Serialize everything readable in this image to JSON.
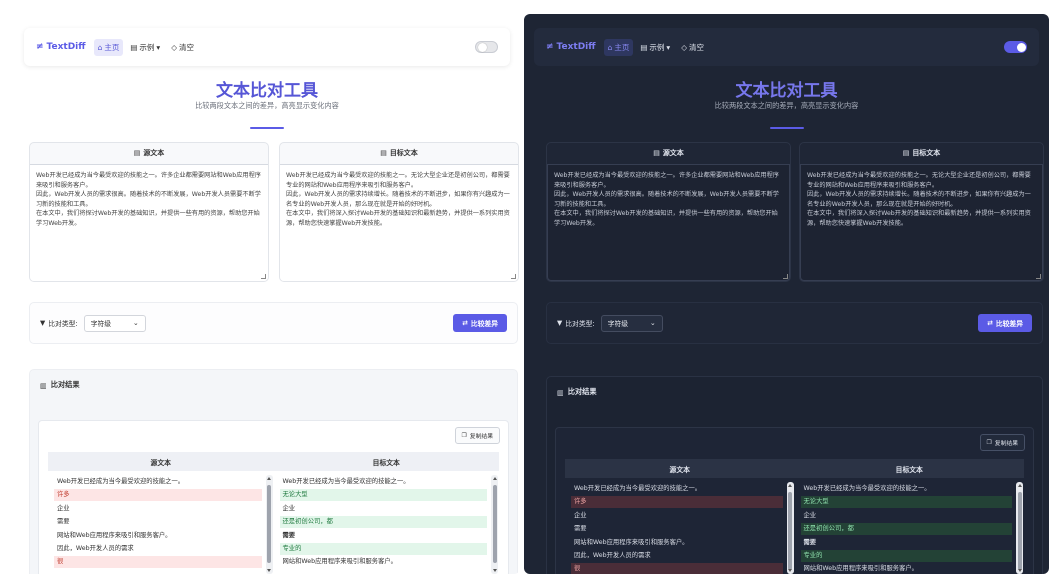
{
  "nav": {
    "brand": "TextDiff",
    "home": "主页",
    "examples": "示例",
    "clear": "清空"
  },
  "hero": {
    "title": "文本比对工具",
    "subtitle": "比较两段文本之间的差异，高亮显示变化内容"
  },
  "source": {
    "label": "源文本",
    "text": "Web开发已经成为当今最受欢迎的技能之一。许多企业都需要网站和Web应用程序来吸引和服务客户。\n因此，Web开发人员的需求很高。随着技术的不断发展，Web开发人员需要不断学习新的技能和工具。\n在本文中，我们将探讨Web开发的基础知识，并提供一些有用的资源，帮助您开始学习Web开发。"
  },
  "target": {
    "label": "目标文本",
    "text": "Web开发已经成为当今最受欢迎的技能之一。无论大型企业还是初创公司，都需要专业的网站和Web应用程序来吸引和服务客户。\n因此，Web开发人员的需求持续增长。随着技术的不断进步，如果你有兴趣成为一名专业的Web开发人员，那么现在就是开始的好时机。\n在本文中，我们将深入探讨Web开发的基础知识和最新趋势，并提供一系列实用资源，帮助您快速掌握Web开发技能。"
  },
  "controls": {
    "compare_type_label": "比对类型:",
    "compare_type_value": "字符级",
    "compare_button": "比较差异"
  },
  "results": {
    "title": "比对结果",
    "copy_button": "复制结果",
    "col_source": "源文本",
    "col_target": "目标文本",
    "left_lines": [
      {
        "text": "Web开发已经成为当今最受欢迎的技能之一。",
        "type": "same"
      },
      {
        "text": "许多",
        "type": "del"
      },
      {
        "text": "企业",
        "type": "same"
      },
      {
        "text": "需要",
        "type": "same"
      },
      {
        "text": "网站和Web应用程序来吸引和服务客户。",
        "type": "same"
      },
      {
        "text": "因此，Web开发人员的需求",
        "type": "same"
      },
      {
        "text": "很",
        "type": "del"
      }
    ],
    "right_lines": [
      {
        "text": "Web开发已经成为当今最受欢迎的技能之一。",
        "type": "same"
      },
      {
        "text": "无论大型",
        "type": "add"
      },
      {
        "text": "企业",
        "type": "same"
      },
      {
        "text": "还是初创公司，都",
        "type": "add"
      },
      {
        "text": "需要",
        "type": "bold"
      },
      {
        "text": "专业的",
        "type": "add"
      },
      {
        "text": "网站和Web应用程序来吸引和服务客户。",
        "type": "same"
      }
    ]
  },
  "theme": {
    "accent": "#5b5be6",
    "light_toggle": "off",
    "dark_toggle": "on"
  }
}
